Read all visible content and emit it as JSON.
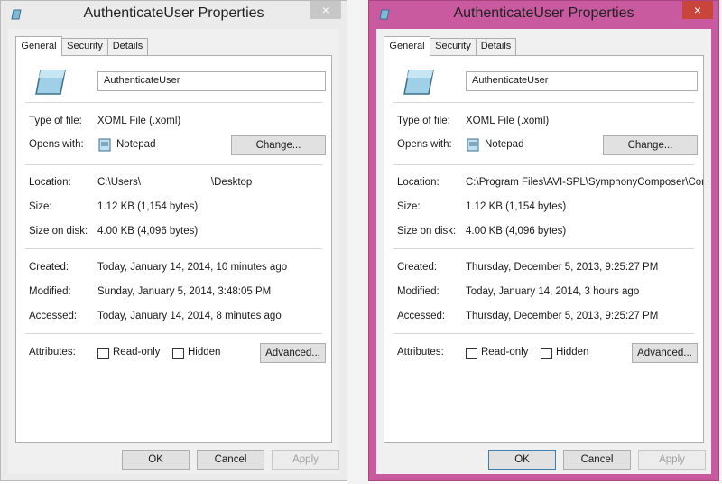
{
  "windows": [
    {
      "title": "AuthenticateUser Properties",
      "tabs": [
        "General",
        "Security",
        "Details"
      ],
      "name_value": "AuthenticateUser",
      "type_label": "Type of file:",
      "type_value": "XOML File (.xoml)",
      "opens_label": "Opens with:",
      "opens_value": "Notepad",
      "change_label": "Change...",
      "location_label": "Location:",
      "location_prefix": "C:\\Users\\",
      "location_suffix": "\\Desktop",
      "size_label": "Size:",
      "size_value": "1.12 KB (1,154 bytes)",
      "disk_label": "Size on disk:",
      "disk_value": "4.00 KB (4,096 bytes)",
      "created_label": "Created:",
      "created_value": "Today, January 14, 2014, 10 minutes ago",
      "modified_label": "Modified:",
      "modified_value": "Sunday, January 5, 2014, 3:48:05 PM",
      "accessed_label": "Accessed:",
      "accessed_value": "Today, January 14, 2014, 8 minutes ago",
      "attributes_label": "Attributes:",
      "readonly_label": "Read-only",
      "hidden_label": "Hidden",
      "advanced_label": "Advanced...",
      "ok_label": "OK",
      "cancel_label": "Cancel",
      "apply_label": "Apply",
      "close_glyph": "×"
    },
    {
      "title": "AuthenticateUser Properties",
      "tabs": [
        "General",
        "Security",
        "Details"
      ],
      "name_value": "AuthenticateUser",
      "type_label": "Type of file:",
      "type_value": "XOML File (.xoml)",
      "opens_label": "Opens with:",
      "opens_value": "Notepad",
      "change_label": "Change...",
      "location_label": "Location:",
      "location_value": "C:\\Program Files\\AVI-SPL\\SymphonyComposer\\Con",
      "size_label": "Size:",
      "size_value": "1.12 KB (1,154 bytes)",
      "disk_label": "Size on disk:",
      "disk_value": "4.00 KB (4,096 bytes)",
      "created_label": "Created:",
      "created_value": "Thursday, December 5, 2013, 9:25:27 PM",
      "modified_label": "Modified:",
      "modified_value": "Today, January 14, 2014, 3 hours ago",
      "accessed_label": "Accessed:",
      "accessed_value": "Thursday, December 5, 2013, 9:25:27 PM",
      "attributes_label": "Attributes:",
      "readonly_label": "Read-only",
      "hidden_label": "Hidden",
      "advanced_label": "Advanced...",
      "ok_label": "OK",
      "cancel_label": "Cancel",
      "apply_label": "Apply",
      "close_glyph": "×"
    }
  ],
  "colors": {
    "active_frame": "#c95aa0",
    "inactive_frame": "#ebebeb",
    "close_active": "#c7453b"
  }
}
